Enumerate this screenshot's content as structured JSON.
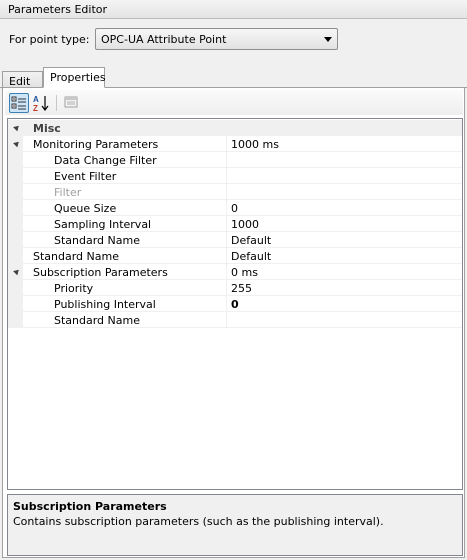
{
  "window": {
    "title": "Parameters Editor"
  },
  "point_type": {
    "label": "For point type:",
    "selected": "OPC-UA Attribute Point"
  },
  "tabs": [
    {
      "label": "Edit",
      "active": false
    },
    {
      "label": "Properties",
      "active": true
    }
  ],
  "toolbar": {
    "categorized_icon": "categorized-view-icon",
    "alphabetical_icon": "alphabetical-sort-icon",
    "pages_icon": "property-pages-icon"
  },
  "grid": {
    "category": "Misc",
    "rows": [
      {
        "name": "Monitoring Parameters",
        "value": "1000 ms",
        "indent": 1,
        "expanded": true
      },
      {
        "name": "Data Change Filter",
        "value": "",
        "indent": 2
      },
      {
        "name": "Event Filter",
        "value": "",
        "indent": 2
      },
      {
        "name": "Filter",
        "value": "",
        "indent": 2,
        "disabled": true
      },
      {
        "name": "Queue Size",
        "value": "0",
        "indent": 2
      },
      {
        "name": "Sampling Interval",
        "value": "1000",
        "indent": 2
      },
      {
        "name": "Standard Name",
        "value": "Default",
        "indent": 2
      },
      {
        "name": "Standard Name",
        "value": "Default",
        "indent": 1
      },
      {
        "name": "Subscription Parameters",
        "value": "0 ms",
        "indent": 1,
        "expanded": true
      },
      {
        "name": "Priority",
        "value": "255",
        "indent": 2
      },
      {
        "name": "Publishing Interval",
        "value": "0",
        "indent": 2,
        "bold_value": true
      },
      {
        "name": "Standard Name",
        "value": "",
        "indent": 2
      }
    ]
  },
  "help": {
    "title": "Subscription Parameters",
    "description": "Contains subscription parameters (such as the publishing interval)."
  }
}
